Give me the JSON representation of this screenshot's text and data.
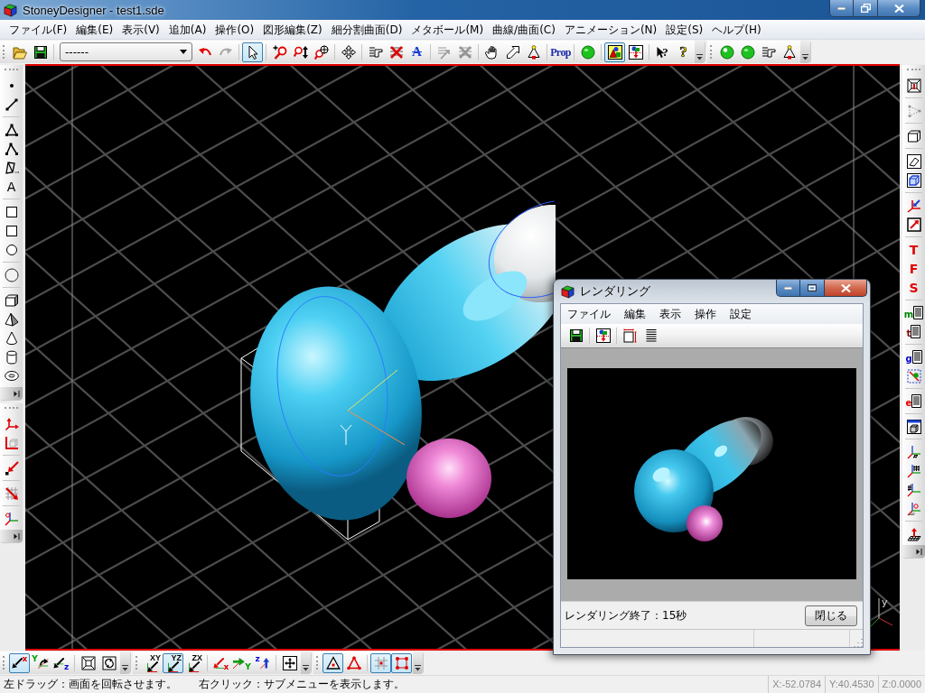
{
  "window": {
    "title": "StoneyDesigner - test1.sde"
  },
  "menu": [
    "ファイル(F)",
    "編集(E)",
    "表示(V)",
    "追加(A)",
    "操作(O)",
    "図形編集(Z)",
    "細分割曲面(D)",
    "メタボール(M)",
    "曲線/曲面(C)",
    "アニメーション(N)",
    "設定(S)",
    "ヘルプ(H)"
  ],
  "toolbar_top": [
    {
      "groups": [
        {
          "tools": [
            {
              "kind": "open",
              "pressed": false,
              "disabled": false
            },
            {
              "kind": "save",
              "pressed": false,
              "disabled": false
            }
          ]
        },
        {
          "combo": {
            "value": "------"
          },
          "tools": [
            {
              "kind": "undo",
              "pressed": false,
              "disabled": false
            },
            {
              "kind": "redo",
              "pressed": false,
              "disabled": true
            }
          ]
        },
        {
          "tools": [
            {
              "kind": "select",
              "pressed": true,
              "disabled": false
            }
          ]
        },
        {
          "tools": [
            {
              "kind": "zoomin",
              "pressed": false,
              "disabled": false
            },
            {
              "kind": "zoomv",
              "pressed": false,
              "disabled": false
            },
            {
              "kind": "zoomarea",
              "pressed": false,
              "disabled": false
            }
          ]
        },
        {
          "tools": [
            {
              "kind": "move",
              "pressed": false,
              "disabled": false
            }
          ]
        },
        {
          "tools": [
            {
              "kind": "pointer",
              "pressed": false,
              "disabled": false
            },
            {
              "kind": "crosslines",
              "pressed": false,
              "disabled": false
            },
            {
              "kind": "strike",
              "label": "A",
              "pressed": false,
              "disabled": false
            }
          ]
        },
        {
          "tools": [
            {
              "kind": "linesarrow",
              "pressed": false,
              "disabled": true
            },
            {
              "kind": "linescross",
              "pressed": false,
              "disabled": true
            }
          ]
        },
        {
          "tools": [
            {
              "kind": "hand",
              "pressed": false,
              "disabled": false
            },
            {
              "kind": "arrowoutline",
              "pressed": false,
              "disabled": false
            },
            {
              "kind": "triangle",
              "pressed": false,
              "disabled": false
            }
          ]
        },
        {
          "tools": [
            {
              "kind": "prop",
              "label": "Prop",
              "pressed": false,
              "disabled": false
            }
          ]
        },
        {
          "tools": [
            {
              "kind": "sphere",
              "pressed": false,
              "disabled": false
            }
          ]
        },
        {
          "tools": [
            {
              "kind": "picture",
              "pressed": true,
              "disabled": false
            },
            {
              "kind": "picturearrow",
              "pressed": false,
              "disabled": false
            }
          ]
        },
        {
          "tools": [
            {
              "kind": "helppointer",
              "label": "?",
              "pressed": false,
              "disabled": false
            },
            {
              "kind": "help",
              "label": "?",
              "pressed": false,
              "disabled": false
            }
          ]
        }
      ]
    },
    {
      "groups": [
        {
          "tools": [
            {
              "kind": "shinysphere",
              "pressed": false,
              "disabled": false
            },
            {
              "kind": "sphere",
              "pressed": false,
              "disabled": false
            },
            {
              "kind": "pointer",
              "pressed": false,
              "disabled": false
            },
            {
              "kind": "triangle",
              "pressed": false,
              "disabled": false
            }
          ]
        }
      ]
    }
  ],
  "toolbar_left": [
    {
      "groups": [
        {
          "tools": [
            {
              "kind": "dot",
              "pressed": false,
              "disabled": false
            },
            {
              "kind": "segment",
              "pressed": false,
              "disabled": false
            }
          ]
        },
        {
          "tools": [
            {
              "kind": "tri",
              "pressed": false,
              "disabled": false
            },
            {
              "kind": "polyline",
              "pressed": false,
              "disabled": false
            },
            {
              "kind": "polygon",
              "pressed": false,
              "disabled": false
            },
            {
              "kind": "letter",
              "label": "A",
              "pressed": false,
              "disabled": false
            }
          ]
        },
        {
          "tools": [
            {
              "kind": "square",
              "pressed": false,
              "disabled": false
            },
            {
              "kind": "square",
              "pressed": false,
              "disabled": false
            },
            {
              "kind": "circle",
              "pressed": false,
              "disabled": false
            }
          ]
        },
        {
          "tools": [
            {
              "kind": "ball",
              "pressed": false,
              "disabled": false
            }
          ]
        },
        {
          "tools": [
            {
              "kind": "cube",
              "pressed": false,
              "disabled": false
            },
            {
              "kind": "pyramid",
              "pressed": false,
              "disabled": false
            },
            {
              "kind": "cone",
              "pressed": false,
              "disabled": false
            },
            {
              "kind": "cylinder",
              "pressed": false,
              "disabled": false
            },
            {
              "kind": "torus",
              "pressed": false,
              "disabled": false
            }
          ]
        }
      ]
    },
    {
      "groups": [
        {
          "tools": [
            {
              "kind": "axisarrows",
              "pressed": false,
              "disabled": false
            },
            {
              "kind": "boxcorner",
              "pressed": false,
              "disabled": false
            }
          ]
        },
        {
          "tools": [
            {
              "kind": "redarrow",
              "pressed": false,
              "disabled": false
            }
          ]
        },
        {
          "tools": [
            {
              "kind": "gridarrow",
              "pressed": false,
              "disabled": false
            }
          ]
        },
        {
          "tools": [
            {
              "kind": "gizmo",
              "pressed": false,
              "disabled": false
            }
          ]
        }
      ]
    }
  ],
  "toolbar_right": [
    {
      "groups": [
        {
          "tools": [
            {
              "kind": "viewbox",
              "pressed": false,
              "disabled": false
            }
          ]
        },
        {
          "tools": [
            {
              "kind": "dottedtri",
              "pressed": false,
              "disabled": true
            }
          ]
        },
        {
          "tools": [
            {
              "kind": "cubewire",
              "pressed": false,
              "disabled": false
            }
          ]
        },
        {
          "tools": [
            {
              "kind": "eraser",
              "pressed": false,
              "disabled": false
            },
            {
              "kind": "bluebox",
              "pressed": false,
              "disabled": false
            }
          ]
        },
        {
          "tools": [
            {
              "kind": "axesarrow",
              "pressed": false,
              "disabled": false
            },
            {
              "kind": "boxarrow",
              "pressed": false,
              "disabled": false
            }
          ]
        },
        {
          "tools": [
            {
              "kind": "redletter",
              "label": "T",
              "pressed": false,
              "disabled": false
            },
            {
              "kind": "redletter",
              "label": "F",
              "pressed": false,
              "disabled": false
            },
            {
              "kind": "redletter",
              "label": "S",
              "pressed": false,
              "disabled": false
            }
          ]
        },
        {
          "tools": [
            {
              "kind": "doc",
              "label": "m",
              "color": "#008800",
              "pressed": false,
              "disabled": false
            },
            {
              "kind": "doc",
              "label": "t",
              "color": "#880000",
              "pressed": false,
              "disabled": false
            }
          ]
        },
        {
          "tools": [
            {
              "kind": "doc",
              "label": "g",
              "color": "#0000cc",
              "pressed": false,
              "disabled": false
            },
            {
              "kind": "selection",
              "pressed": false,
              "disabled": false
            }
          ]
        },
        {
          "tools": [
            {
              "kind": "doc",
              "label": "e",
              "color": "#e00000",
              "pressed": false,
              "disabled": false
            }
          ]
        },
        {
          "tools": [
            {
              "kind": "window",
              "pressed": false,
              "disabled": false
            }
          ]
        },
        {
          "tools": [
            {
              "kind": "gridfloor",
              "pressed": false,
              "disabled": false
            },
            {
              "kind": "gridwall",
              "pressed": false,
              "disabled": false
            },
            {
              "kind": "gridside",
              "pressed": false,
              "disabled": false
            },
            {
              "kind": "gridorigin",
              "pressed": false,
              "disabled": false
            }
          ]
        },
        {
          "tools": [
            {
              "kind": "gridup",
              "pressed": false,
              "disabled": false
            }
          ]
        }
      ]
    }
  ],
  "viewport": {
    "axis_label": "y"
  },
  "toolbar_bottom": [
    {
      "groups": [
        {
          "tools": [
            {
              "kind": "viewx",
              "label": "x",
              "color": "#e00000",
              "pressed": true,
              "disabled": false
            },
            {
              "kind": "viewy",
              "label": "Y",
              "color": "#00a000",
              "pressed": false,
              "disabled": false
            },
            {
              "kind": "viewz",
              "label": "z",
              "color": "#0000e0",
              "pressed": false,
              "disabled": false
            }
          ]
        },
        {
          "tools": [
            {
              "kind": "fit",
              "pressed": false,
              "disabled": false
            },
            {
              "kind": "rotate",
              "pressed": false,
              "disabled": false
            }
          ]
        }
      ]
    },
    {
      "groups": [
        {
          "tools": [
            {
              "kind": "plane",
              "label": "XY",
              "pressed": false,
              "disabled": false
            },
            {
              "kind": "plane",
              "label": "YZ",
              "pressed": true,
              "disabled": false
            },
            {
              "kind": "plane",
              "label": "ZX",
              "pressed": false,
              "disabled": false
            }
          ]
        },
        {
          "tools": [
            {
              "kind": "movex",
              "label": "x",
              "color": "#e00000",
              "pressed": false,
              "disabled": false
            },
            {
              "kind": "movey",
              "label": "Y",
              "color": "#00a000",
              "pressed": false,
              "disabled": false
            },
            {
              "kind": "movez",
              "label": "z",
              "color": "#0000e0",
              "pressed": false,
              "disabled": false
            }
          ]
        },
        {
          "tools": [
            {
              "kind": "crosshair",
              "pressed": false,
              "disabled": false
            }
          ]
        }
      ]
    },
    {
      "groups": [
        {
          "tools": [
            {
              "kind": "tridot",
              "pressed": true,
              "disabled": false
            },
            {
              "kind": "trivertex",
              "pressed": false,
              "disabled": false
            }
          ]
        },
        {
          "tools": [
            {
              "kind": "gridcenter",
              "pressed": true,
              "disabled": false
            },
            {
              "kind": "dotsquare",
              "pressed": true,
              "disabled": false
            }
          ]
        }
      ]
    }
  ],
  "status_bar": {
    "hints": [
      "左ドラッグ：画面を回転させます。",
      "右クリック：サブメニューを表示します。"
    ],
    "coords": [
      "X:-52.0784",
      "Y:40.4530",
      "Z:0.0000"
    ]
  },
  "render_dialog": {
    "title": "レンダリング",
    "menu": [
      "ファイル",
      "編集",
      "表示",
      "操作",
      "設定"
    ],
    "toolbar": {
      "groups": [
        {
          "tools": [
            {
              "kind": "save",
              "pressed": false,
              "disabled": false
            }
          ]
        },
        {
          "tools": [
            {
              "kind": "picturearrow",
              "pressed": false,
              "disabled": false
            }
          ]
        },
        {
          "tools": [
            {
              "kind": "framesize",
              "pressed": false,
              "disabled": false
            },
            {
              "kind": "list",
              "pressed": false,
              "disabled": false
            }
          ]
        }
      ]
    },
    "status": "レンダリング終了：15秒",
    "close_button": "閉じる"
  }
}
